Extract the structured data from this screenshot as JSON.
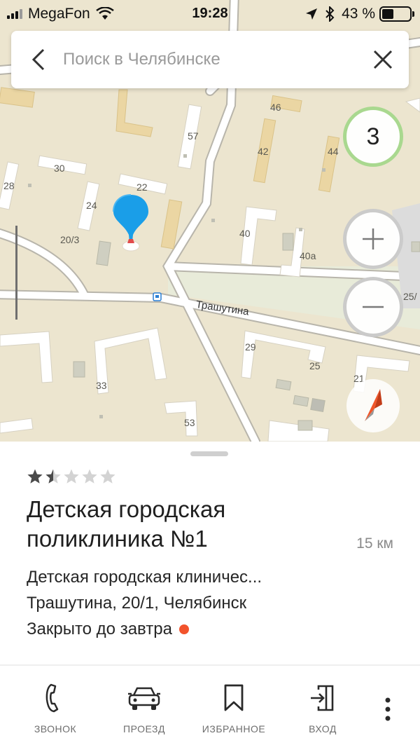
{
  "status_bar": {
    "carrier": "MegaFon",
    "time": "19:28",
    "battery": "43 %",
    "battery_level": 0.43,
    "icons": [
      "signal-icon",
      "wifi-icon",
      "location-arrow-icon",
      "bluetooth-icon",
      "battery-icon"
    ]
  },
  "search": {
    "placeholder": "Поиск в Челябинске",
    "value": ""
  },
  "map": {
    "street_name": "Трашутина",
    "house_numbers": [
      "46",
      "42",
      "44",
      "57",
      "30",
      "28",
      "22",
      "24",
      "20/3",
      "40",
      "40а",
      "25/",
      "29",
      "25",
      "21",
      "33",
      "53"
    ],
    "traffic_level": "3",
    "traffic_color": "#a9d88f",
    "pin_color": "#1a9ee8",
    "compass_color": "#f0562a",
    "bus_stop_icon": "bus-stop-icon"
  },
  "place": {
    "rating_stars": 1.5,
    "rating_max": 5,
    "title": "Детская городская поликлиника №1",
    "distance": "15 км",
    "category": "Детская городская клиничес...",
    "address": "Трашутина, 20/1, Челябинск",
    "hours": "Закрыто до завтра",
    "status_color": "#f2532c"
  },
  "actions": [
    {
      "label": "ЗВОНОК",
      "icon": "phone-icon"
    },
    {
      "label": "ПРОЕЗД",
      "icon": "car-icon"
    },
    {
      "label": "ИЗБРАННОЕ",
      "icon": "bookmark-icon"
    },
    {
      "label": "ВХОД",
      "icon": "entrance-icon"
    }
  ],
  "more_icon": "more-vertical-icon"
}
